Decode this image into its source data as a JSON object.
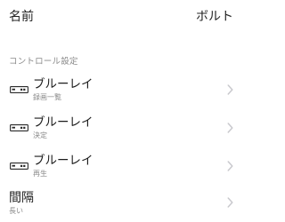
{
  "name_row": {
    "title": "名前",
    "value": "ボルト"
  },
  "section": {
    "header": "コントロール設定"
  },
  "controls": [
    {
      "icon": "remote-device-icon",
      "label": "ブルーレイ",
      "sub": "録画一覧"
    },
    {
      "icon": "remote-device-icon",
      "label": "ブルーレイ",
      "sub": "決定"
    },
    {
      "icon": "remote-device-icon",
      "label": "ブルーレイ",
      "sub": "再生"
    }
  ],
  "interval": {
    "label": "間隔",
    "sub": "長い"
  },
  "colors": {
    "text": "#1c1c1c",
    "secondary": "#8a8a8a",
    "chevron": "#c7c7cc",
    "background": "#ffffff"
  }
}
